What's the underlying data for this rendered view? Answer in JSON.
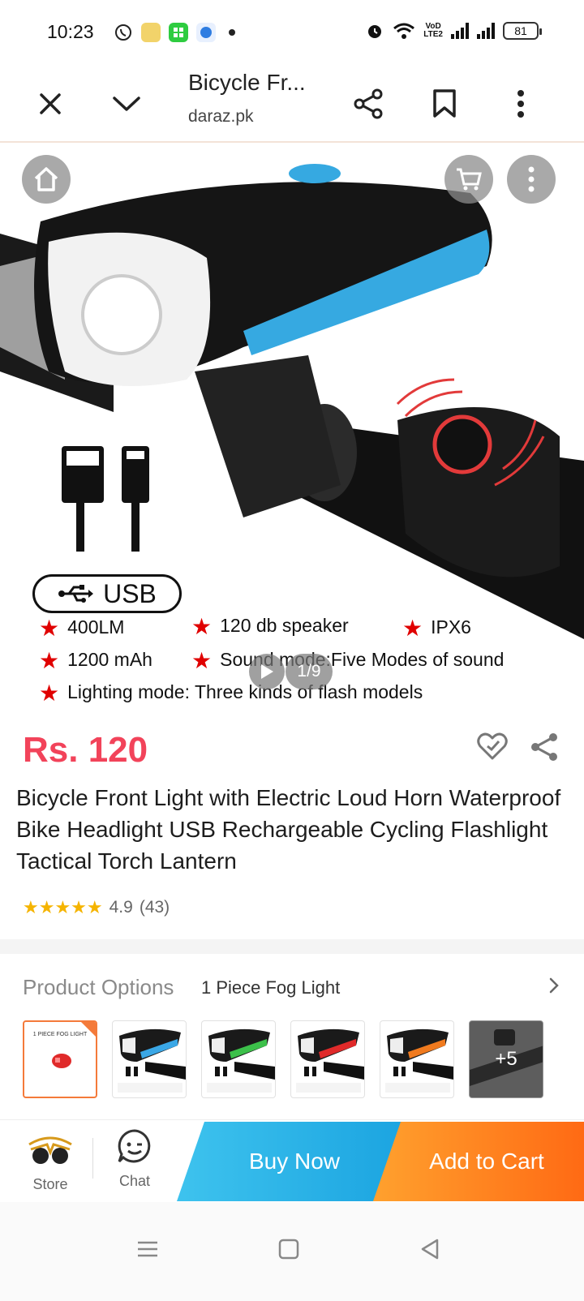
{
  "status_bar": {
    "time": "10:23",
    "network_label_top": "VoD",
    "network_label_bottom": "LTE2",
    "battery": "81"
  },
  "browser": {
    "title": "Bicycle Fr...",
    "url": "daraz.pk"
  },
  "hero": {
    "usb_label": "USB",
    "image_counter": "1/9",
    "specs": [
      "400LM",
      "120 db speaker",
      "IPX6",
      "1200 mAh",
      "Sound mode:Five Modes of sound",
      "Lighting mode: Three kinds of flash models"
    ]
  },
  "product": {
    "price": "Rs. 120",
    "title": "Bicycle Front Light with Electric Loud Horn Waterproof Bike Headlight USB Rechargeable Cycling Flashlight Tactical Torch Lantern",
    "rating": "4.9",
    "rating_count": "(43)",
    "rating_stars": 4.9
  },
  "options": {
    "label": "Product Options",
    "selected": "1 Piece Fog Light",
    "first_thumb_label": "1 PIECE FOG LIGHT",
    "thumb_accents": [
      "#3aa7e6",
      "#3cc04a",
      "#e02a2a",
      "#f07a1e"
    ],
    "more_label": "+5"
  },
  "action_bar": {
    "store_label": "Store",
    "chat_label": "Chat",
    "buy_now": "Buy Now",
    "add_to_cart": "Add to Cart"
  },
  "colors": {
    "price": "#f2435a",
    "buy_now": "#1aa3e0",
    "add_to_cart": "#ff6a14",
    "selected_border": "#f47a3a"
  }
}
